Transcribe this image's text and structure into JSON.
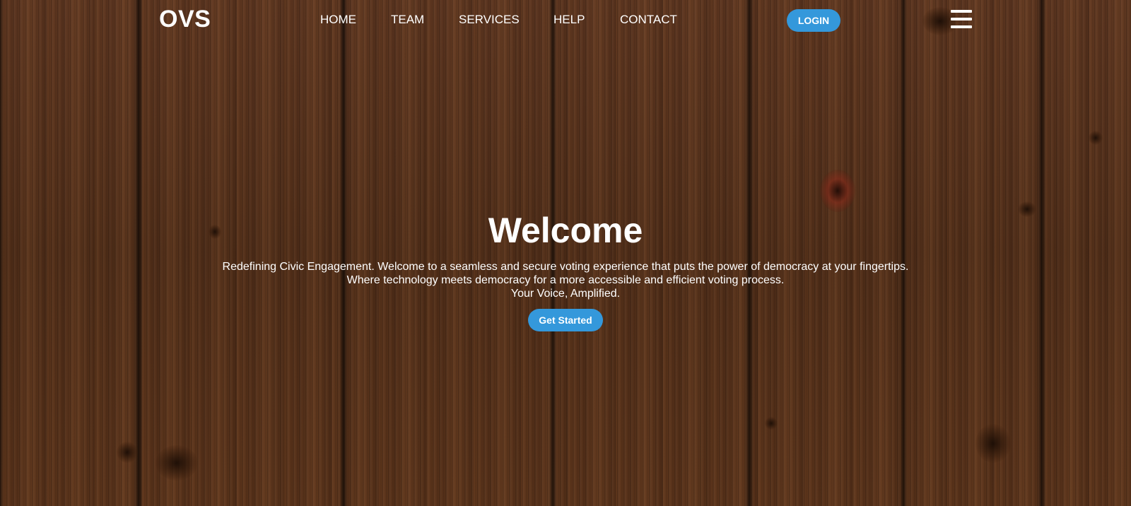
{
  "brand": {
    "logo_text": "OVS"
  },
  "nav": {
    "items": [
      {
        "label": "HOME"
      },
      {
        "label": "TEAM"
      },
      {
        "label": "SERVICES"
      },
      {
        "label": "HELP"
      },
      {
        "label": "CONTACT"
      }
    ],
    "login_label": "LOGIN",
    "menu_icon": "hamburger-menu-icon"
  },
  "hero": {
    "title": "Welcome",
    "lines": [
      "Redefining Civic Engagement. Welcome to a seamless and secure voting experience that puts the power of democracy at your fingertips.",
      "Where technology meets democracy for a more accessible and efficient voting process.",
      "Your Voice, Amplified."
    ],
    "cta_label": "Get Started"
  },
  "colors": {
    "accent": "#3498db",
    "text": "#ffffff",
    "background": "#4a2a17"
  }
}
